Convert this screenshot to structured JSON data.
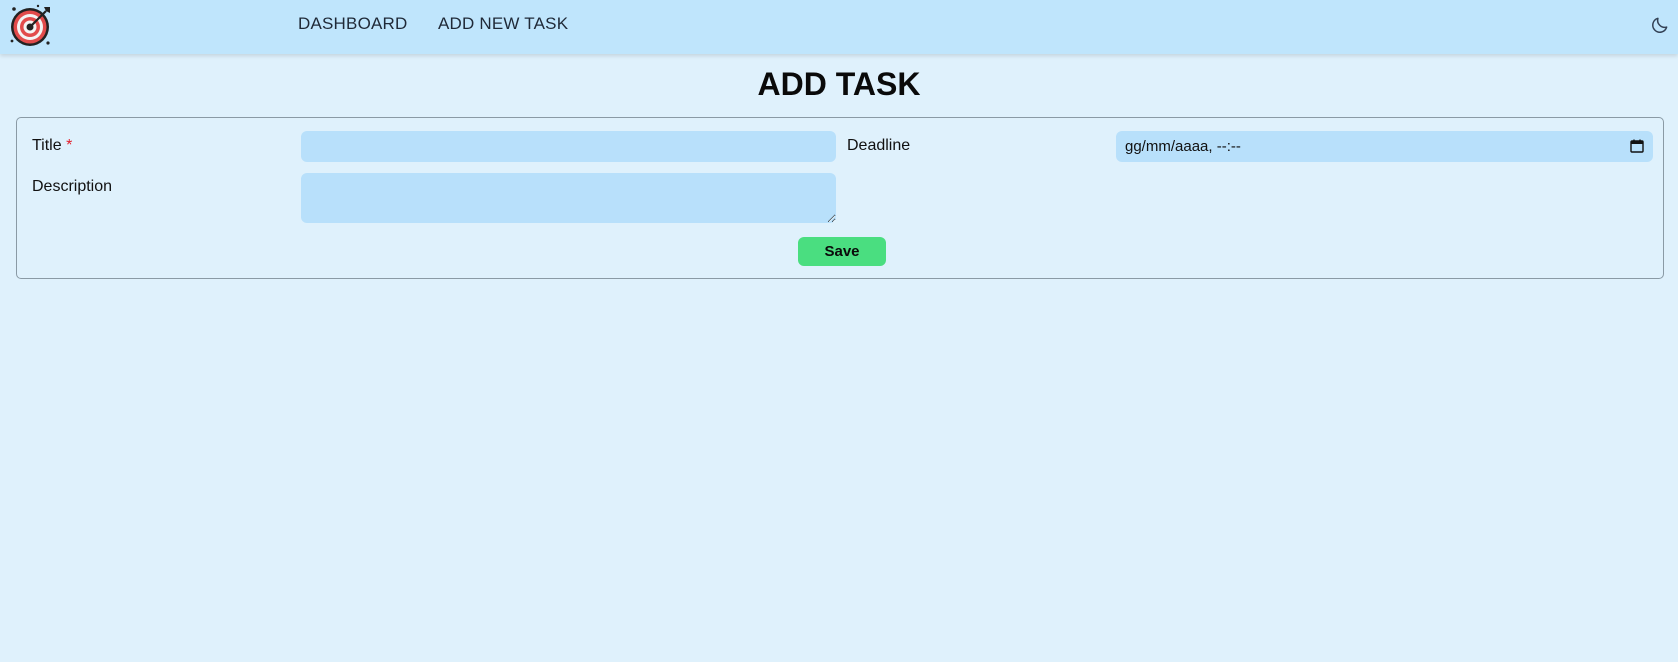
{
  "navbar": {
    "logo_icon": "target-icon",
    "links": [
      {
        "label": "DASHBOARD"
      },
      {
        "label": "ADD NEW TASK"
      }
    ],
    "theme_toggle_icon": "moon-icon"
  },
  "page": {
    "title": "ADD TASK"
  },
  "form": {
    "title_label": "Title",
    "required_marker": "*",
    "title_value": "",
    "description_label": "Description",
    "description_value": "",
    "deadline_label": "Deadline",
    "deadline_placeholder": "gg/mm/aaaa, --:--",
    "calendar_icon": "calendar-icon",
    "save_label": "Save"
  },
  "colors": {
    "background": "#dff1fc",
    "navbar": "#bfe5fc",
    "input": "#b8e0fb",
    "save_button": "#4ade80",
    "required": "#e11d2a"
  }
}
